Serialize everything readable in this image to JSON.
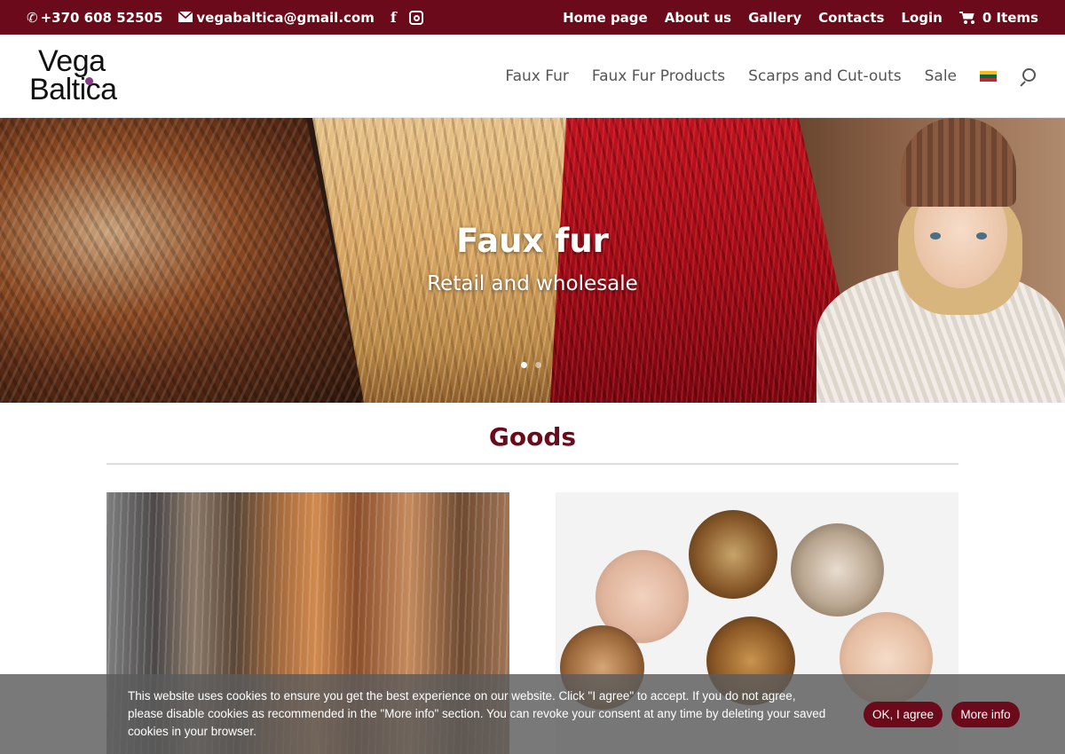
{
  "topbar": {
    "phone": "+370 608 52505",
    "email": "vegabaltica@gmail.com",
    "nav": [
      "Home page",
      "About us",
      "Gallery",
      "Contacts",
      "Login"
    ],
    "cart_label": "0 Items"
  },
  "header": {
    "logo_line1": "Vega",
    "logo_line2": "Baltica",
    "nav": [
      "Faux Fur",
      "Faux Fur Products",
      "Scarps and Cut-outs",
      "Sale"
    ],
    "flag_colors": [
      "#fdb913",
      "#006a44",
      "#c1272d"
    ]
  },
  "hero": {
    "title": "Faux fur",
    "subtitle": "Retail and wholesale",
    "slides": 2,
    "active_slide": 1
  },
  "goods": {
    "title": "Goods"
  },
  "cookie": {
    "text": "This website uses cookies to ensure you get the best experience on our website. Click \"I agree\" to accept. If you do not agree, please disable cookies as recommended in the \"More info\" section. You can revoke your consent at any time by deleting your saved cookies in your browser.",
    "agree_label": "OK, I agree",
    "more_label": "More info"
  },
  "colors": {
    "brand": "#6b0a1a",
    "nav_text": "#555555"
  }
}
